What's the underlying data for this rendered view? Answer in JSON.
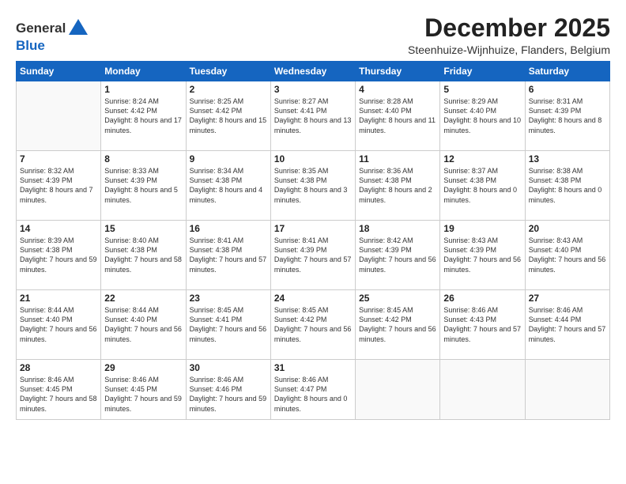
{
  "logo": {
    "general": "General",
    "blue": "Blue"
  },
  "header": {
    "month": "December 2025",
    "location": "Steenhuize-Wijnhuize, Flanders, Belgium"
  },
  "days_of_week": [
    "Sunday",
    "Monday",
    "Tuesday",
    "Wednesday",
    "Thursday",
    "Friday",
    "Saturday"
  ],
  "weeks": [
    [
      {
        "day": "",
        "info": ""
      },
      {
        "day": "1",
        "info": "Sunrise: 8:24 AM\nSunset: 4:42 PM\nDaylight: 8 hours\nand 17 minutes."
      },
      {
        "day": "2",
        "info": "Sunrise: 8:25 AM\nSunset: 4:42 PM\nDaylight: 8 hours\nand 15 minutes."
      },
      {
        "day": "3",
        "info": "Sunrise: 8:27 AM\nSunset: 4:41 PM\nDaylight: 8 hours\nand 13 minutes."
      },
      {
        "day": "4",
        "info": "Sunrise: 8:28 AM\nSunset: 4:40 PM\nDaylight: 8 hours\nand 11 minutes."
      },
      {
        "day": "5",
        "info": "Sunrise: 8:29 AM\nSunset: 4:40 PM\nDaylight: 8 hours\nand 10 minutes."
      },
      {
        "day": "6",
        "info": "Sunrise: 8:31 AM\nSunset: 4:39 PM\nDaylight: 8 hours\nand 8 minutes."
      }
    ],
    [
      {
        "day": "7",
        "info": "Sunrise: 8:32 AM\nSunset: 4:39 PM\nDaylight: 8 hours\nand 7 minutes."
      },
      {
        "day": "8",
        "info": "Sunrise: 8:33 AM\nSunset: 4:39 PM\nDaylight: 8 hours\nand 5 minutes."
      },
      {
        "day": "9",
        "info": "Sunrise: 8:34 AM\nSunset: 4:38 PM\nDaylight: 8 hours\nand 4 minutes."
      },
      {
        "day": "10",
        "info": "Sunrise: 8:35 AM\nSunset: 4:38 PM\nDaylight: 8 hours\nand 3 minutes."
      },
      {
        "day": "11",
        "info": "Sunrise: 8:36 AM\nSunset: 4:38 PM\nDaylight: 8 hours\nand 2 minutes."
      },
      {
        "day": "12",
        "info": "Sunrise: 8:37 AM\nSunset: 4:38 PM\nDaylight: 8 hours\nand 0 minutes."
      },
      {
        "day": "13",
        "info": "Sunrise: 8:38 AM\nSunset: 4:38 PM\nDaylight: 8 hours\nand 0 minutes."
      }
    ],
    [
      {
        "day": "14",
        "info": "Sunrise: 8:39 AM\nSunset: 4:38 PM\nDaylight: 7 hours\nand 59 minutes."
      },
      {
        "day": "15",
        "info": "Sunrise: 8:40 AM\nSunset: 4:38 PM\nDaylight: 7 hours\nand 58 minutes."
      },
      {
        "day": "16",
        "info": "Sunrise: 8:41 AM\nSunset: 4:38 PM\nDaylight: 7 hours\nand 57 minutes."
      },
      {
        "day": "17",
        "info": "Sunrise: 8:41 AM\nSunset: 4:39 PM\nDaylight: 7 hours\nand 57 minutes."
      },
      {
        "day": "18",
        "info": "Sunrise: 8:42 AM\nSunset: 4:39 PM\nDaylight: 7 hours\nand 56 minutes."
      },
      {
        "day": "19",
        "info": "Sunrise: 8:43 AM\nSunset: 4:39 PM\nDaylight: 7 hours\nand 56 minutes."
      },
      {
        "day": "20",
        "info": "Sunrise: 8:43 AM\nSunset: 4:40 PM\nDaylight: 7 hours\nand 56 minutes."
      }
    ],
    [
      {
        "day": "21",
        "info": "Sunrise: 8:44 AM\nSunset: 4:40 PM\nDaylight: 7 hours\nand 56 minutes."
      },
      {
        "day": "22",
        "info": "Sunrise: 8:44 AM\nSunset: 4:40 PM\nDaylight: 7 hours\nand 56 minutes."
      },
      {
        "day": "23",
        "info": "Sunrise: 8:45 AM\nSunset: 4:41 PM\nDaylight: 7 hours\nand 56 minutes."
      },
      {
        "day": "24",
        "info": "Sunrise: 8:45 AM\nSunset: 4:42 PM\nDaylight: 7 hours\nand 56 minutes."
      },
      {
        "day": "25",
        "info": "Sunrise: 8:45 AM\nSunset: 4:42 PM\nDaylight: 7 hours\nand 56 minutes."
      },
      {
        "day": "26",
        "info": "Sunrise: 8:46 AM\nSunset: 4:43 PM\nDaylight: 7 hours\nand 57 minutes."
      },
      {
        "day": "27",
        "info": "Sunrise: 8:46 AM\nSunset: 4:44 PM\nDaylight: 7 hours\nand 57 minutes."
      }
    ],
    [
      {
        "day": "28",
        "info": "Sunrise: 8:46 AM\nSunset: 4:45 PM\nDaylight: 7 hours\nand 58 minutes."
      },
      {
        "day": "29",
        "info": "Sunrise: 8:46 AM\nSunset: 4:45 PM\nDaylight: 7 hours\nand 59 minutes."
      },
      {
        "day": "30",
        "info": "Sunrise: 8:46 AM\nSunset: 4:46 PM\nDaylight: 7 hours\nand 59 minutes."
      },
      {
        "day": "31",
        "info": "Sunrise: 8:46 AM\nSunset: 4:47 PM\nDaylight: 8 hours\nand 0 minutes."
      },
      {
        "day": "",
        "info": ""
      },
      {
        "day": "",
        "info": ""
      },
      {
        "day": "",
        "info": ""
      }
    ]
  ]
}
